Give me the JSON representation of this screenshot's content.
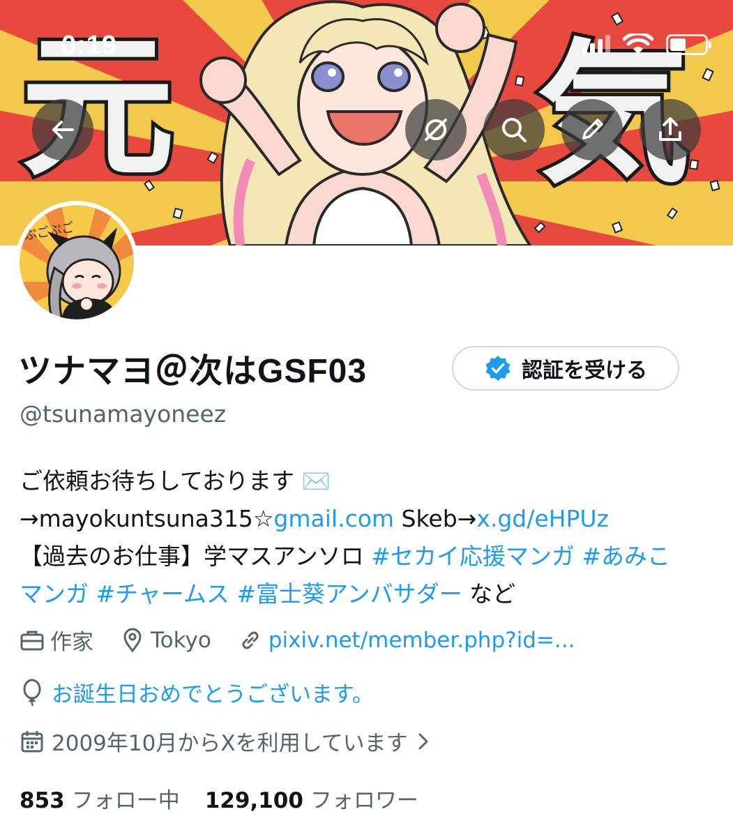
{
  "status_bar": {
    "time": "0:19"
  },
  "banner": {
    "kanji_left": "元",
    "kanji_right": "気",
    "buttons": [
      {
        "name": "back-button",
        "icon": "arrow-left-icon"
      },
      {
        "name": "grok-button",
        "icon": "grok-icon"
      },
      {
        "name": "search-button",
        "icon": "search-icon"
      },
      {
        "name": "edit-button",
        "icon": "pencil-icon"
      },
      {
        "name": "share-button",
        "icon": "upload-icon"
      }
    ]
  },
  "profile": {
    "display_name": "ツナマヨ＠次はGSF03",
    "handle": "@tsunamayoneez",
    "verify_button_label": "認証を受ける",
    "avatar_text": "ぷごぷご"
  },
  "bio": {
    "line1": "ご依頼お待ちしております ✉️",
    "line2_prefix": "→mayokuntsuna315☆",
    "line2_link1": "gmail.com",
    "line2_mid": " Skeb→",
    "line2_link2": "x.gd/eHPUz",
    "line3_prefix": "【過去のお仕事】学マスアンソロ ",
    "hashtag1": "#セカイ応援マンガ",
    "hashtag2_part1": "#あみこ",
    "hashtag2_part2": "マンガ",
    "hashtag3": "#チャームス",
    "hashtag4": "#富士葵アンバサダー",
    "suffix": " など"
  },
  "meta": {
    "profession": "作家",
    "location": "Tokyo",
    "website": "pixiv.net/member.php?id=...",
    "birthday": "お誕生日おめでとうございます。",
    "joined": "2009年10月からXを利用しています"
  },
  "stats": {
    "following_count": "853",
    "following_label": "フォロー中",
    "followers_count": "129,100",
    "followers_label": "フォロワー"
  },
  "colors": {
    "link": "#1d9bf0",
    "secondary_text": "#536471",
    "primary_text": "#0f1419",
    "banner_red": "#e8493f",
    "banner_yellow": "#f2c94c"
  }
}
